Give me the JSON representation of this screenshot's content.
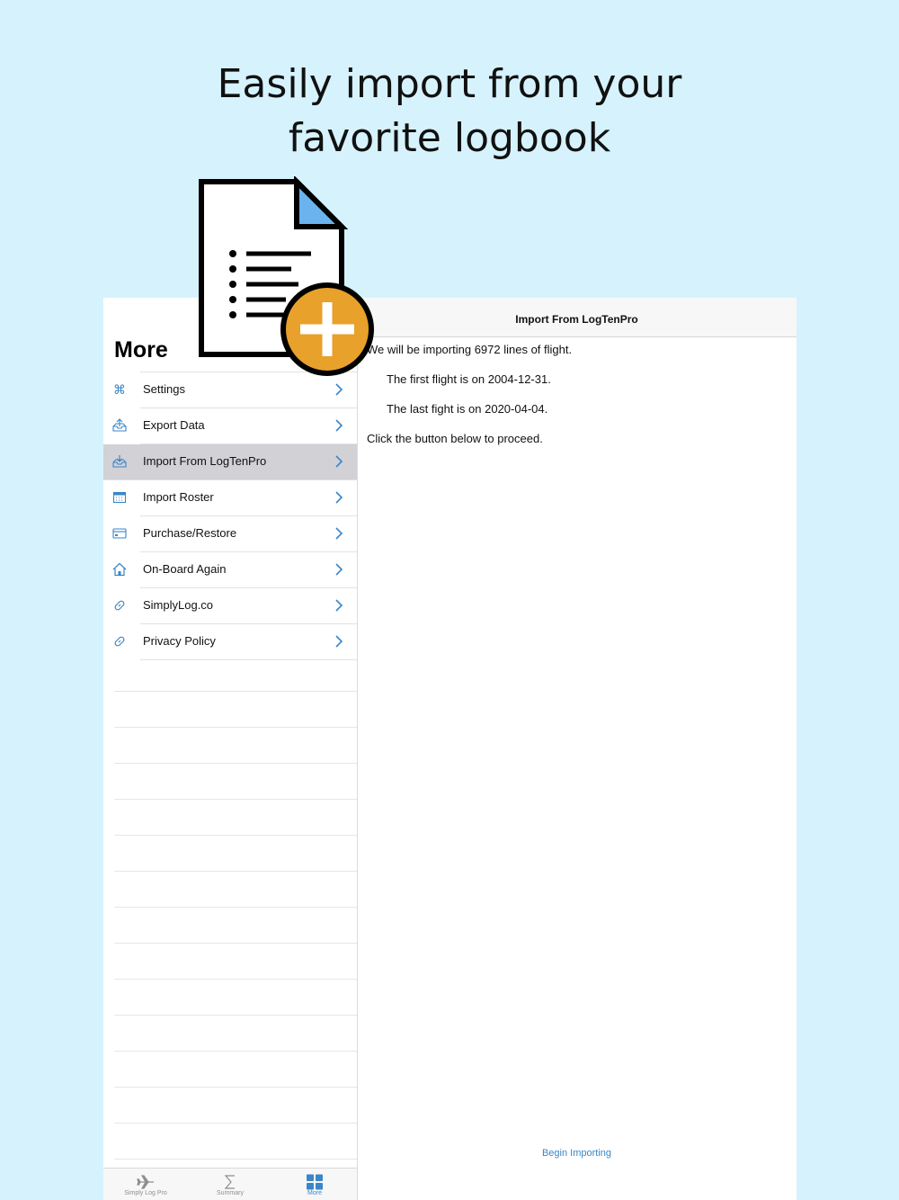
{
  "headline": {
    "line1": "Easily import from your",
    "line2": "favorite logbook"
  },
  "sidebar": {
    "title": "More",
    "items": [
      {
        "label": "Settings",
        "icon": "command-icon"
      },
      {
        "label": "Export Data",
        "icon": "tray-upload-icon"
      },
      {
        "label": "Import From LogTenPro",
        "icon": "tray-download-icon",
        "selected": true
      },
      {
        "label": "Import Roster",
        "icon": "calendar-icon"
      },
      {
        "label": "Purchase/Restore",
        "icon": "credit-card-icon"
      },
      {
        "label": "On-Board Again",
        "icon": "home-icon"
      },
      {
        "label": "SimplyLog.co",
        "icon": "link-icon"
      },
      {
        "label": "Privacy Policy",
        "icon": "link-icon"
      }
    ]
  },
  "tabbar": {
    "tabs": [
      {
        "label": "Simply Log Pro",
        "icon": "airplane-icon"
      },
      {
        "label": "Summary",
        "icon": "sigma-icon"
      },
      {
        "label": "More",
        "icon": "grid-icon",
        "active": true
      }
    ]
  },
  "detail": {
    "title": "Import From LogTenPro",
    "line1": "We will be importing 6972 lines of flight.",
    "line2": "The first flight is on 2004-12-31.",
    "line3": "The last fight is on 2020-04-04.",
    "line4": "Click the button below to proceed.",
    "begin_button": "Begin Importing"
  },
  "colors": {
    "background": "#d6f3fd",
    "accent": "#3a86c8",
    "badge_orange": "#e8a12a",
    "doc_corner_blue": "#6ab3ee",
    "selected_row": "#d1d1d6"
  }
}
